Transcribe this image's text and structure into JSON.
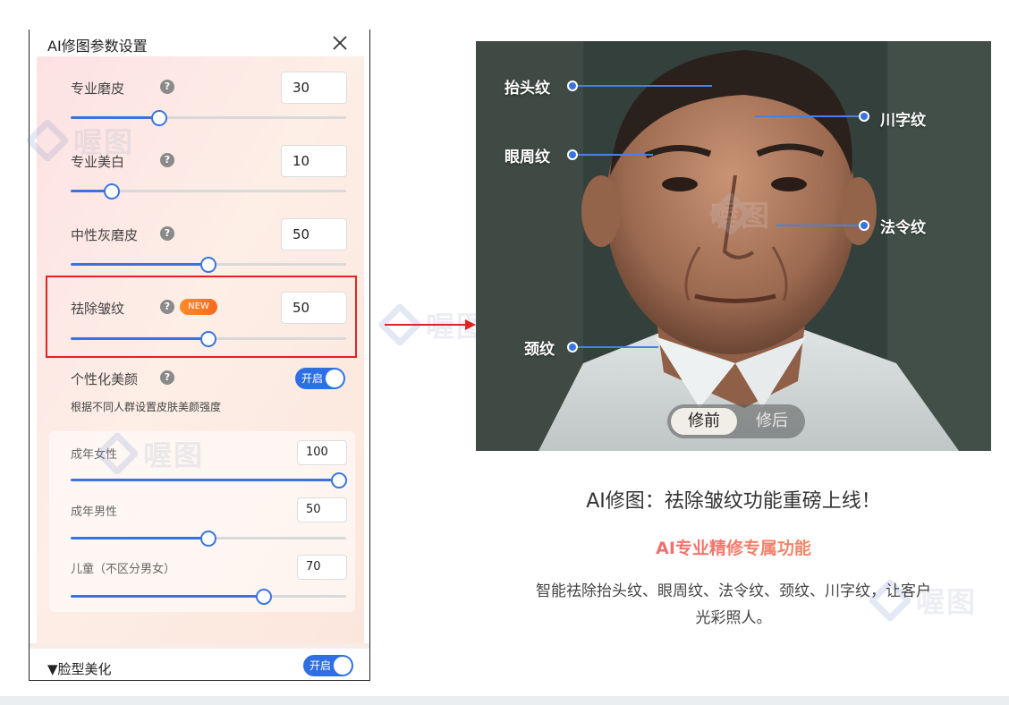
{
  "panel": {
    "title": "AI修图参数设置",
    "rows": [
      {
        "label": "专业磨皮",
        "value": "30",
        "percent": 32
      },
      {
        "label": "专业美白",
        "value": "10",
        "percent": 15
      },
      {
        "label": "中性灰磨皮",
        "value": "50",
        "percent": 50
      },
      {
        "label": "祛除皱纹",
        "value": "50",
        "percent": 50,
        "badge": "NEW"
      }
    ],
    "help_glyph": "?",
    "personal": {
      "label": "个性化美颜",
      "toggle_label": "开启",
      "desc": "根据不同人群设置皮肤美颜强度"
    },
    "groups": [
      {
        "label": "成年女性",
        "value": "100",
        "percent": 100
      },
      {
        "label": "成年男性",
        "value": "50",
        "percent": 50
      },
      {
        "label": "儿童（不区分男女）",
        "value": "70",
        "percent": 70
      }
    ],
    "footer": {
      "title": "▼脸型美化",
      "toggle_label": "开启"
    }
  },
  "watermark": "喔图",
  "photo": {
    "callouts": {
      "forehead": "抬头纹",
      "eye": "眼周纹",
      "neck": "颈纹",
      "glabella": "川字纹",
      "nasolabial": "法令纹"
    },
    "before_label": "修前",
    "after_label": "修后"
  },
  "promo": {
    "title": "AI修图：祛除皱纹功能重磅上线！",
    "subtitle": "AI专业精修专属功能",
    "description": "智能祛除抬头纹、眼周纹、法令纹、颈纹、川字纹，让客户光彩照人。"
  },
  "colors": {
    "accent": "#3a73e0",
    "highlight": "#e02424",
    "badge": "#f46a1f"
  }
}
